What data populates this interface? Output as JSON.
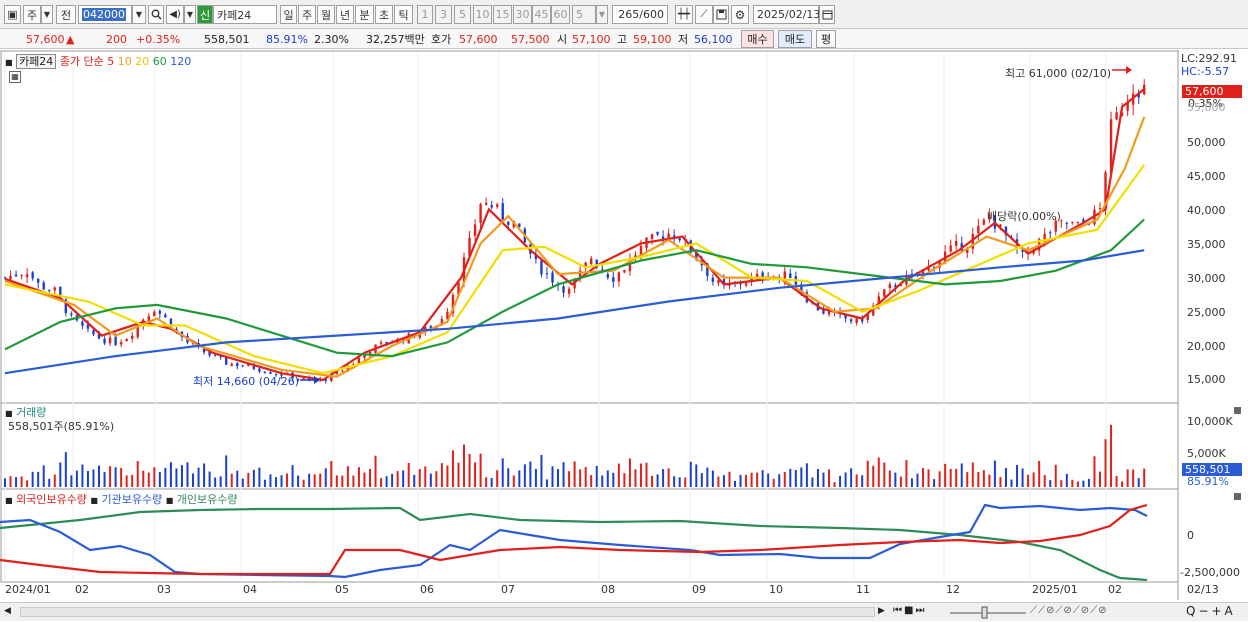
{
  "toolbar": {
    "period_label": "주",
    "prev_label": "전",
    "code_value": "042000",
    "new_label": "신",
    "stock_name": "카페24",
    "tabs": [
      "일",
      "주",
      "월",
      "년",
      "분",
      "초",
      "틱"
    ],
    "active_tab": "일",
    "intervals": [
      "1",
      "3",
      "5",
      "10",
      "15",
      "30",
      "45",
      "60"
    ],
    "interval_value": "5",
    "count_value": "265",
    "count_total": "/600",
    "date_value": "2025/02/13"
  },
  "quote": {
    "price": "57,600",
    "price_arrow": "▲",
    "change": "200",
    "change_pct": "+0.35%",
    "volume": "558,501",
    "turnover_pct": "85.91%",
    "ratio": "2.30%",
    "amount": "32,257백만",
    "ask_label": "호가",
    "ask1": "57,600",
    "ask2": "57,500",
    "open_label": "시",
    "open": "57,100",
    "high_label": "고",
    "high": "59,100",
    "low_label": "저",
    "low": "56,100",
    "buy_btn": "매수",
    "sell_btn": "매도",
    "eval_btn": "평"
  },
  "legend": {
    "name": "카페24",
    "label": "종가 단순",
    "ma": [
      {
        "period": "5",
        "color": "#e0201b"
      },
      {
        "period": "10",
        "color": "#f39a1e"
      },
      {
        "period": "20",
        "color": "#f2de00"
      },
      {
        "period": "60",
        "color": "#1f9a3a"
      },
      {
        "period": "120",
        "color": "#2b5cd6"
      }
    ]
  },
  "annotations": {
    "high": "최고 61,000 (02/10)",
    "low": "최저 14,660 (04/26)",
    "exdiv": "배당락(0.00%)"
  },
  "right_info": {
    "lc": "LC:292.91",
    "hc": "HC:-5.57",
    "price_box": "57,600",
    "pct_box": "0.35%",
    "vol_box": "558,501",
    "vol_pct_box": "85.91%"
  },
  "price_axis": [
    "55,000",
    "50,000",
    "45,000",
    "40,000",
    "35,000",
    "30,000",
    "25,000",
    "20,000",
    "15,000"
  ],
  "volume_panel": {
    "title": "거래량",
    "value": "558,501주(85.91%)",
    "axis": [
      "10,000K",
      "5,000K"
    ]
  },
  "holdings_panel": {
    "series": [
      {
        "name": "외국인보유수량",
        "color": "#e0201b"
      },
      {
        "name": "기관보유수량",
        "color": "#2b5cd6"
      },
      {
        "name": "개인보유수량",
        "color": "#2e8b57"
      }
    ],
    "axis": [
      "0",
      "-2,500,000"
    ]
  },
  "date_axis": [
    "2024/01",
    "02",
    "03",
    "04",
    "05",
    "06",
    "07",
    "08",
    "09",
    "10",
    "11",
    "12",
    "2025/01",
    "02",
    "02/13"
  ],
  "chart_data": {
    "type": "candlestick",
    "title": "카페24",
    "ylim": [
      12000,
      62000
    ],
    "price_path": [
      [
        0,
        30000
      ],
      [
        8,
        31000
      ],
      [
        12,
        29000
      ],
      [
        18,
        28000
      ],
      [
        24,
        24000
      ],
      [
        30,
        22000
      ],
      [
        35,
        21000
      ],
      [
        40,
        20500
      ],
      [
        45,
        21500
      ],
      [
        50,
        24000
      ],
      [
        54,
        25500
      ],
      [
        58,
        24000
      ],
      [
        62,
        22000
      ],
      [
        66,
        20500
      ],
      [
        70,
        19500
      ],
      [
        75,
        18500
      ],
      [
        80,
        17500
      ],
      [
        88,
        17000
      ],
      [
        96,
        16200
      ],
      [
        104,
        15500
      ],
      [
        110,
        14800
      ],
      [
        116,
        15200
      ],
      [
        120,
        16000
      ],
      [
        126,
        17500
      ],
      [
        132,
        19500
      ],
      [
        138,
        20500
      ],
      [
        144,
        21000
      ],
      [
        150,
        22000
      ],
      [
        156,
        23000
      ],
      [
        160,
        25500
      ],
      [
        164,
        30000
      ],
      [
        168,
        35000
      ],
      [
        172,
        41000
      ],
      [
        176,
        40500
      ],
      [
        180,
        39000
      ],
      [
        184,
        38000
      ],
      [
        188,
        35000
      ],
      [
        192,
        32000
      ],
      [
        196,
        30500
      ],
      [
        200,
        29000
      ],
      [
        204,
        28000
      ],
      [
        208,
        30500
      ],
      [
        212,
        33000
      ],
      [
        216,
        31000
      ],
      [
        220,
        30000
      ],
      [
        224,
        31500
      ],
      [
        228,
        33500
      ],
      [
        232,
        35000
      ],
      [
        236,
        36000
      ],
      [
        240,
        36500
      ],
      [
        244,
        36000
      ],
      [
        248,
        34000
      ],
      [
        252,
        32000
      ],
      [
        256,
        29500
      ],
      [
        260,
        28500
      ],
      [
        264,
        29000
      ],
      [
        268,
        29500
      ],
      [
        272,
        30000
      ],
      [
        276,
        30500
      ],
      [
        280,
        30000
      ],
      [
        284,
        30500
      ],
      [
        288,
        28000
      ],
      [
        292,
        26000
      ],
      [
        296,
        25000
      ],
      [
        300,
        24500
      ],
      [
        304,
        24000
      ],
      [
        308,
        23500
      ],
      [
        312,
        24500
      ],
      [
        316,
        27000
      ],
      [
        320,
        28500
      ],
      [
        324,
        29500
      ],
      [
        328,
        30000
      ],
      [
        332,
        31000
      ],
      [
        336,
        32000
      ],
      [
        340,
        33500
      ],
      [
        344,
        34500
      ],
      [
        348,
        35000
      ],
      [
        352,
        37000
      ],
      [
        356,
        39000
      ],
      [
        360,
        37000
      ],
      [
        364,
        35000
      ],
      [
        368,
        33000
      ],
      [
        372,
        34500
      ],
      [
        376,
        36000
      ],
      [
        380,
        37500
      ],
      [
        384,
        38000
      ],
      [
        388,
        37500
      ],
      [
        392,
        38500
      ],
      [
        396,
        40000
      ],
      [
        400,
        52000
      ],
      [
        404,
        55000
      ],
      [
        408,
        58000
      ],
      [
        412,
        57600
      ]
    ],
    "ma_series": [
      {
        "name": "5",
        "color": "#e0201b",
        "values": [
          [
            0,
            29800
          ],
          [
            20,
            27000
          ],
          [
            35,
            21500
          ],
          [
            50,
            23500
          ],
          [
            60,
            22500
          ],
          [
            75,
            19000
          ],
          [
            100,
            16000
          ],
          [
            115,
            15000
          ],
          [
            130,
            19000
          ],
          [
            150,
            22000
          ],
          [
            165,
            30000
          ],
          [
            175,
            40000
          ],
          [
            190,
            34000
          ],
          [
            205,
            29000
          ],
          [
            215,
            32000
          ],
          [
            230,
            35000
          ],
          [
            245,
            36000
          ],
          [
            260,
            29000
          ],
          [
            280,
            30000
          ],
          [
            295,
            25500
          ],
          [
            310,
            24000
          ],
          [
            325,
            29500
          ],
          [
            345,
            34000
          ],
          [
            358,
            38000
          ],
          [
            370,
            33500
          ],
          [
            390,
            38000
          ],
          [
            398,
            40000
          ],
          [
            404,
            55000
          ],
          [
            412,
            57600
          ]
        ]
      },
      {
        "name": "10",
        "color": "#f39a1e",
        "values": [
          [
            0,
            29500
          ],
          [
            25,
            26000
          ],
          [
            40,
            21500
          ],
          [
            55,
            24000
          ],
          [
            70,
            20000
          ],
          [
            100,
            16500
          ],
          [
            120,
            15500
          ],
          [
            140,
            20000
          ],
          [
            160,
            23500
          ],
          [
            172,
            35000
          ],
          [
            182,
            39000
          ],
          [
            200,
            30500
          ],
          [
            220,
            31000
          ],
          [
            240,
            35500
          ],
          [
            260,
            30000
          ],
          [
            280,
            30000
          ],
          [
            300,
            25000
          ],
          [
            315,
            25500
          ],
          [
            335,
            31000
          ],
          [
            355,
            36000
          ],
          [
            370,
            34000
          ],
          [
            395,
            38500
          ],
          [
            405,
            46000
          ],
          [
            412,
            53500
          ]
        ]
      },
      {
        "name": "20",
        "color": "#f2de00",
        "values": [
          [
            0,
            29000
          ],
          [
            30,
            26500
          ],
          [
            50,
            23000
          ],
          [
            65,
            23000
          ],
          [
            90,
            18500
          ],
          [
            115,
            16000
          ],
          [
            140,
            18500
          ],
          [
            160,
            22000
          ],
          [
            180,
            34000
          ],
          [
            195,
            34500
          ],
          [
            210,
            31500
          ],
          [
            230,
            33000
          ],
          [
            250,
            35000
          ],
          [
            270,
            30000
          ],
          [
            290,
            29500
          ],
          [
            310,
            25000
          ],
          [
            330,
            28000
          ],
          [
            350,
            31500
          ],
          [
            370,
            35000
          ],
          [
            395,
            37000
          ],
          [
            412,
            46500
          ]
        ]
      },
      {
        "name": "60",
        "color": "#1f9a3a",
        "values": [
          [
            0,
            19500
          ],
          [
            20,
            23500
          ],
          [
            40,
            25500
          ],
          [
            55,
            26000
          ],
          [
            80,
            24000
          ],
          [
            100,
            21500
          ],
          [
            120,
            19000
          ],
          [
            140,
            18500
          ],
          [
            160,
            20500
          ],
          [
            180,
            25000
          ],
          [
            200,
            29000
          ],
          [
            230,
            32500
          ],
          [
            250,
            34000
          ],
          [
            270,
            32000
          ],
          [
            290,
            31500
          ],
          [
            320,
            30000
          ],
          [
            340,
            29000
          ],
          [
            360,
            29500
          ],
          [
            380,
            31000
          ],
          [
            400,
            34000
          ],
          [
            412,
            38500
          ]
        ]
      },
      {
        "name": "120",
        "color": "#2b5cd6",
        "values": [
          [
            0,
            16000
          ],
          [
            40,
            18500
          ],
          [
            80,
            20500
          ],
          [
            120,
            21500
          ],
          [
            160,
            22500
          ],
          [
            200,
            24000
          ],
          [
            240,
            26500
          ],
          [
            280,
            28500
          ],
          [
            320,
            30000
          ],
          [
            360,
            31500
          ],
          [
            390,
            32500
          ],
          [
            412,
            34000
          ]
        ]
      }
    ]
  }
}
